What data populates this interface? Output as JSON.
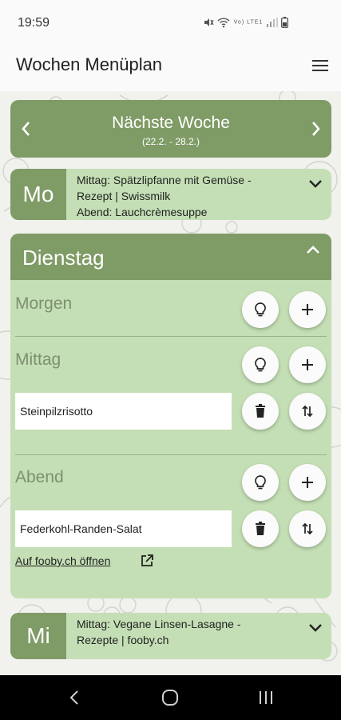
{
  "status_bar": {
    "time": "19:59",
    "icons": [
      "mute-icon",
      "wifi-icon",
      "volte-icon",
      "signal-icon",
      "battery-icon"
    ],
    "icons_text": "Vo) LTE1"
  },
  "app_bar": {
    "title": "Wochen Menüplan",
    "menu_icon": "hamburger-menu-icon"
  },
  "colors": {
    "accent_dark": "#7f9b66",
    "accent_light": "#c4dfb5",
    "meal_label": "#7e8f70"
  },
  "week_nav": {
    "title": "Nächste Woche",
    "range": "(22.2. - 28.2.)"
  },
  "days": [
    {
      "abbr": "Mo",
      "summary_lines": [
        "Mittag: Spätzlipfanne mit Gemüse -",
        "Rezept | Swissmilk",
        "Abend: Lauchcrèmesuppe"
      ],
      "expanded": false
    },
    {
      "title": "Dienstag",
      "expanded": true,
      "meals": [
        {
          "label": "Morgen",
          "dishes": []
        },
        {
          "label": "Mittag",
          "dishes": [
            "Steinpilzrisotto"
          ]
        },
        {
          "label": "Abend",
          "dishes": [
            "Federkohl-Randen-Salat"
          ],
          "link": "Auf fooby.ch öffnen"
        }
      ]
    },
    {
      "abbr": "Mi",
      "summary_lines": [
        "Mittag: Vegane Linsen-Lasagne -",
        "Rezepte | fooby.ch"
      ],
      "expanded": false
    }
  ],
  "nav_bar": {
    "buttons": [
      "back-icon",
      "home-icon",
      "recents-icon"
    ]
  }
}
